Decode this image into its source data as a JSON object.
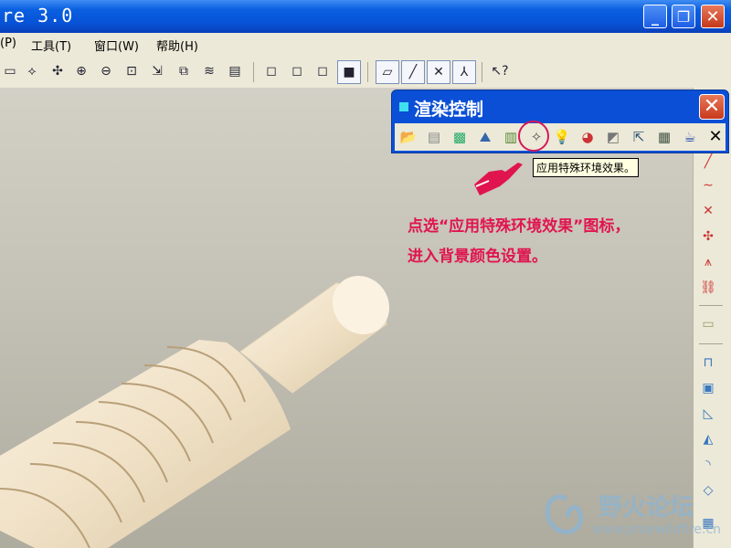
{
  "window": {
    "title": "re 3.0",
    "min": "_",
    "max": "❐",
    "close": "✕"
  },
  "menu": {
    "items": [
      "(P)",
      "工具(T)",
      "窗口(W)",
      "帮助(H)"
    ]
  },
  "dialog": {
    "title": "渲染控制",
    "close": "✕",
    "end_label": "✕"
  },
  "tooltip": {
    "text": "应用特殊环境效果。"
  },
  "note": {
    "line1": "点选“应用特殊环境效果”图标，",
    "line2": "进入背景颜色设置。"
  },
  "watermark": {
    "name": "野火论坛",
    "url": "www.proewildfire.cn"
  },
  "colors": {
    "accent": "#0b4fd6",
    "note": "#e0154f",
    "shaft": "#f3e6d0"
  }
}
